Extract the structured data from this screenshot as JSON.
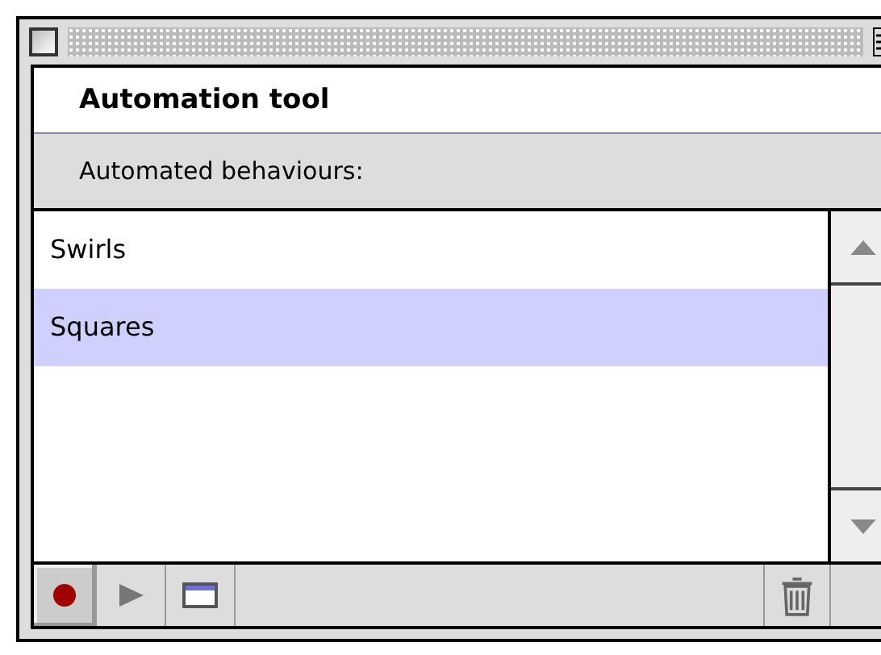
{
  "window": {
    "title": "Automation tool"
  },
  "list_label": "Automated behaviours:",
  "behaviours": [
    {
      "label": "Swirls",
      "selected": false
    },
    {
      "label": "Squares",
      "selected": true
    }
  ]
}
